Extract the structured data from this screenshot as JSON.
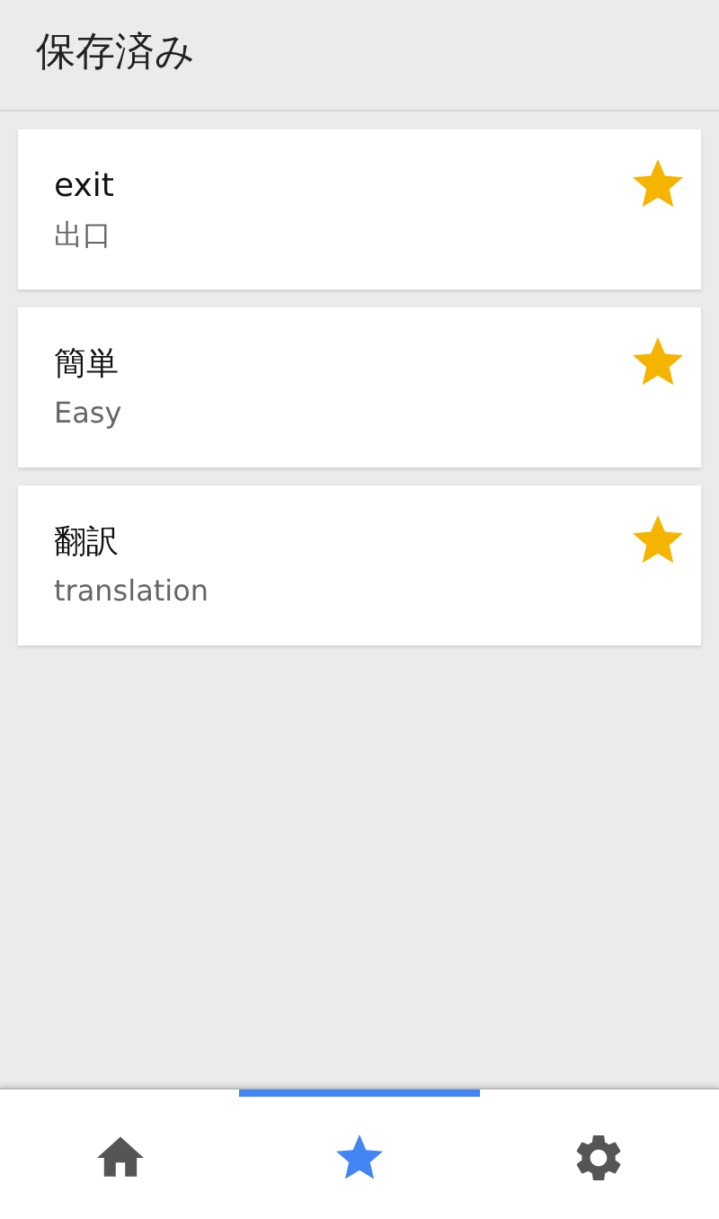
{
  "header": {
    "title": "保存済み"
  },
  "cards": [
    {
      "word": "exit",
      "translation": "出口",
      "saved": true
    },
    {
      "word": "簡単",
      "translation": "Easy",
      "saved": true
    },
    {
      "word": "翻訳",
      "translation": "translation",
      "saved": true
    }
  ],
  "tabs": [
    {
      "kind": "home",
      "selected": false
    },
    {
      "kind": "saved",
      "selected": true
    },
    {
      "kind": "settings",
      "selected": false
    }
  ]
}
